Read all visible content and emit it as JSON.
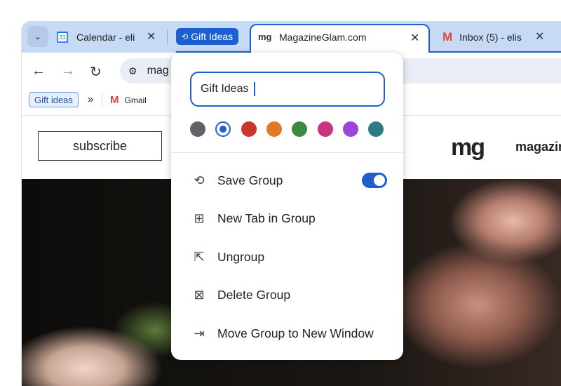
{
  "tabs": [
    {
      "title": "Calendar - eli",
      "icon": "calendar-icon"
    },
    {
      "title": "MagazineGlam.com",
      "icon": "mg-favicon",
      "active": true
    },
    {
      "title": "Inbox (5) - elis",
      "icon": "gmail-icon"
    }
  ],
  "tab_group": {
    "label": "Gift Ideas",
    "color": "#1c5fd0"
  },
  "toolbar": {
    "url": "mag"
  },
  "bookmarks": {
    "group_chip": "Gift ideas",
    "overflow": "»",
    "items": [
      {
        "label": "Gmail"
      }
    ]
  },
  "page": {
    "subscribe": "subscribe",
    "logo": "mg",
    "logo_text": "magazin"
  },
  "menu": {
    "name_value": "Gift Ideas",
    "colors": [
      {
        "name": "grey",
        "hex": "#5f6368"
      },
      {
        "name": "blue",
        "hex": "#1f5fcc",
        "selected": true
      },
      {
        "name": "red",
        "hex": "#c9372c"
      },
      {
        "name": "orange",
        "hex": "#df7a2b"
      },
      {
        "name": "green",
        "hex": "#3f8a3f"
      },
      {
        "name": "pink",
        "hex": "#c7347f"
      },
      {
        "name": "purple",
        "hex": "#9a46d9"
      },
      {
        "name": "teal",
        "hex": "#2f7b83"
      }
    ],
    "items": [
      {
        "label": "Save Group",
        "icon": "sync-icon",
        "toggle": true
      },
      {
        "label": "New Tab in Group",
        "icon": "new-tab-icon"
      },
      {
        "label": "Ungroup",
        "icon": "ungroup-icon"
      },
      {
        "label": "Delete Group",
        "icon": "delete-group-icon"
      },
      {
        "label": "Move Group to New Window",
        "icon": "move-window-icon"
      }
    ]
  }
}
